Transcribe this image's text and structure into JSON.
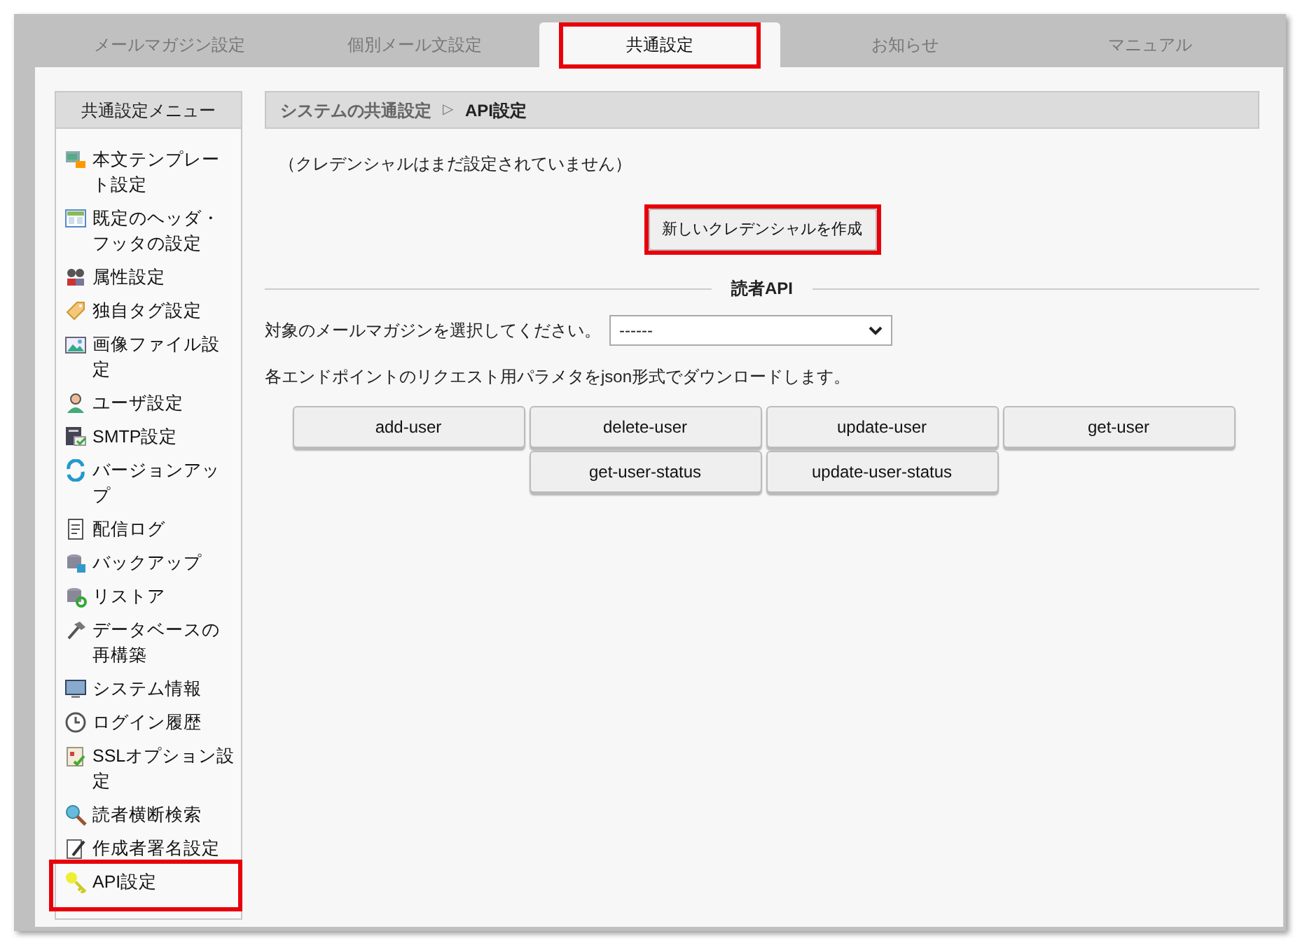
{
  "tabs": [
    {
      "label": "メールマガジン設定",
      "selected": false,
      "highlighted": false
    },
    {
      "label": "個別メール文設定",
      "selected": false,
      "highlighted": false
    },
    {
      "label": "共通設定",
      "selected": true,
      "highlighted": true
    },
    {
      "label": "お知らせ",
      "selected": false,
      "highlighted": false
    },
    {
      "label": "マニュアル",
      "selected": false,
      "highlighted": false
    }
  ],
  "sidebar": {
    "title": "共通設定メニュー",
    "items": [
      {
        "label": "本文テンプレート設定",
        "highlighted": false
      },
      {
        "label": "既定のヘッダ・フッタの設定",
        "highlighted": false
      },
      {
        "label": "属性設定",
        "highlighted": false
      },
      {
        "label": "独自タグ設定",
        "highlighted": false
      },
      {
        "label": "画像ファイル設定",
        "highlighted": false
      },
      {
        "label": "ユーザ設定",
        "highlighted": false
      },
      {
        "label": "SMTP設定",
        "highlighted": false
      },
      {
        "label": "バージョンアップ",
        "highlighted": false
      },
      {
        "label": "配信ログ",
        "highlighted": false
      },
      {
        "label": "バックアップ",
        "highlighted": false
      },
      {
        "label": "リストア",
        "highlighted": false
      },
      {
        "label": "データベースの再構築",
        "highlighted": false
      },
      {
        "label": "システム情報",
        "highlighted": false
      },
      {
        "label": "ログイン履歴",
        "highlighted": false
      },
      {
        "label": "SSLオプション設定",
        "highlighted": false
      },
      {
        "label": "読者横断検索",
        "highlighted": false
      },
      {
        "label": "作成者署名設定",
        "highlighted": false
      },
      {
        "label": "API設定",
        "highlighted": true
      }
    ]
  },
  "breadcrumb": {
    "parent": "システムの共通設定",
    "separator": "▷",
    "current": "API設定"
  },
  "notice": "（クレデンシャルはまだ設定されていません）",
  "create_button": {
    "label": "新しいクレデンシャルを作成",
    "highlighted": true
  },
  "section_title": "読者API",
  "magazine_select": {
    "label": "対象のメールマガジンを選択してください。",
    "value": "------"
  },
  "description": "各エンドポイントのリクエスト用パラメタをjson形式でダウンロードします。",
  "endpoint_buttons": [
    "add-user",
    "delete-user",
    "update-user",
    "get-user",
    "get-user-status",
    "update-user-status"
  ]
}
